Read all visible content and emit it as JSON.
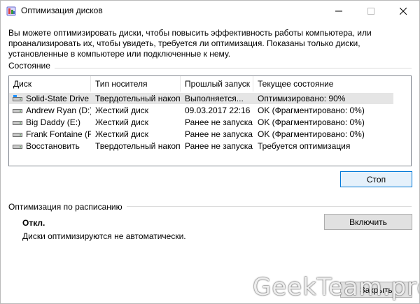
{
  "window": {
    "title": "Оптимизация дисков",
    "minimize_glyph": "—",
    "maximize_glyph": "☐",
    "close_glyph": "✕"
  },
  "intro_text": "Вы можете оптимизировать диски, чтобы повысить эффективность работы  компьютера, или проанализировать их, чтобы увидеть, требуется ли оптимизация. Показаны только диски, установленные в компьютере или подключенные к нему.",
  "status_section": {
    "label": "Состояние",
    "columns": [
      "Диск",
      "Тип носителя",
      "Прошлый запуск",
      "Текущее состояние"
    ],
    "rows": [
      {
        "disk": "Solid-State Drive (C:)",
        "media": "Твердотельный накоп...",
        "last_run": "Выполняется...",
        "status": "Оптимизировано: 90%",
        "icon": "system-drive-icon",
        "selected": true
      },
      {
        "disk": "Andrew Ryan (D:)",
        "media": "Жесткий диск",
        "last_run": "09.03.2017 22:16",
        "status": "OK (Фрагментировано: 0%)",
        "icon": "hard-drive-icon",
        "selected": false
      },
      {
        "disk": "Big Daddy (E:)",
        "media": "Жесткий диск",
        "last_run": "Ранее не запуска...",
        "status": "OK (Фрагментировано: 0%)",
        "icon": "hard-drive-icon",
        "selected": false
      },
      {
        "disk": "Frank Fontaine (F:)",
        "media": "Жесткий диск",
        "last_run": "Ранее не запуска...",
        "status": "OK (Фрагментировано: 0%)",
        "icon": "hard-drive-icon",
        "selected": false
      },
      {
        "disk": "Восстановить",
        "media": "Твердотельный накоп...",
        "last_run": "Ранее не запуска...",
        "status": "Требуется оптимизация",
        "icon": "hard-drive-icon",
        "selected": false
      }
    ],
    "stop_button": "Стоп"
  },
  "schedule_section": {
    "label": "Оптимизация по расписанию",
    "state": "Откл.",
    "description": "Диски оптимизируются не автоматически.",
    "enable_button": "Включить"
  },
  "close_button": "Закрыть",
  "watermark": "GeekTeam.pro",
  "colors": {
    "selection": "#e5e5e5",
    "button_focus_border": "#0078d7",
    "button_bg": "#e1e1e1"
  }
}
